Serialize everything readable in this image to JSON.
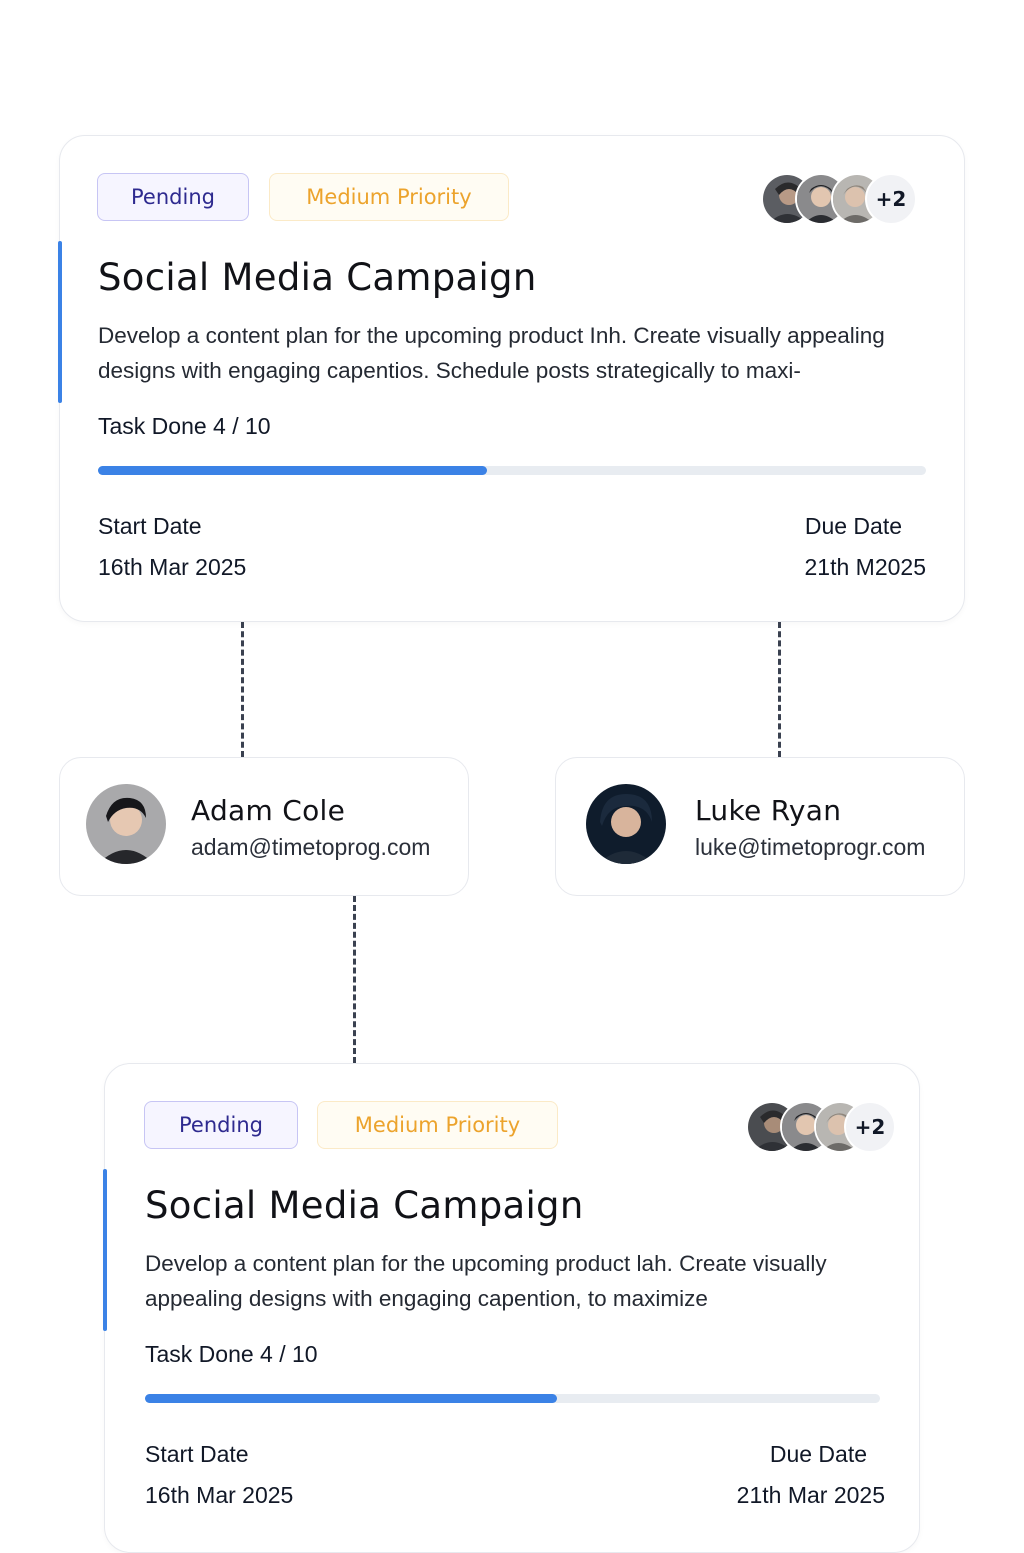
{
  "colors": {
    "accent": "#3b82e6",
    "pending": "#2e2a8f",
    "priority": "#eca32c"
  },
  "cards": [
    {
      "status": "Pending",
      "priority": "Medium Priority",
      "extra_assignees": "+2",
      "title": "Social Media Campaign",
      "description": "Develop a content plan for the upcoming product Inh. Create visually appealing designs with engaging capentios. Schedule posts strategically to maxi-",
      "task_done_label": "Task Done 4 / 10",
      "progress": 0.47,
      "start_label": "Start Date",
      "start_date": "16th Mar 2025",
      "due_label": "Due Date",
      "due_date": "21th M2025"
    },
    {
      "status": "Pending",
      "priority": "Medium Priority",
      "extra_assignees": "+2",
      "title": "Social Media Campaign",
      "description": "Develop a content plan for the upcoming product lah. Create visually appealing designs with engaging capention, to maximize",
      "task_done_label": "Task Done 4 / 10",
      "progress": 0.56,
      "start_label": "Start Date",
      "start_date": "16th Mar 2025",
      "due_label": "Due Date",
      "due_date": "21th Mar 2025"
    }
  ],
  "people": [
    {
      "name": "Adam Cole",
      "email": "adam@timetoprog.com"
    },
    {
      "name": "Luke Ryan",
      "email": "luke@timetoprogr.com"
    }
  ]
}
